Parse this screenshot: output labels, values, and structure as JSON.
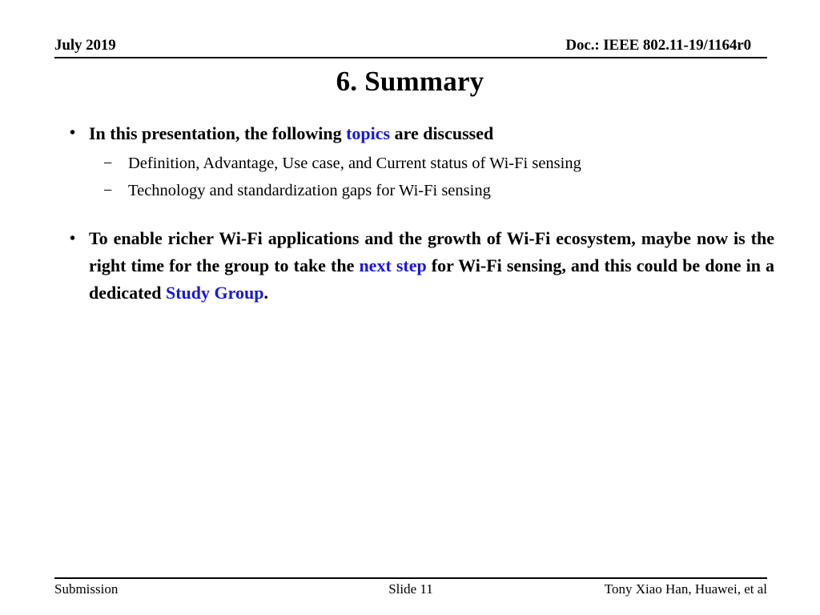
{
  "header": {
    "date": "July 2019",
    "doc_id": "Doc.: IEEE 802.11-19/1164r0"
  },
  "title": "6. Summary",
  "content": {
    "bullet1": {
      "marker": "•",
      "text_before": "In this presentation, the following ",
      "highlight": "topics",
      "text_after": " are discussed",
      "sub_marker": "−",
      "sub_items": [
        "Definition, Advantage, Use case, and Current status of Wi-Fi sensing",
        "Technology and standardization gaps for Wi-Fi sensing"
      ]
    },
    "bullet2": {
      "marker": "•",
      "part1": "To enable richer Wi-Fi applications and the growth of Wi-Fi ecosystem, maybe now is the right time for the group to take the ",
      "highlight1": "next step",
      "part2": " for Wi-Fi sensing, and this could be done in a dedicated ",
      "highlight2": "Study Group",
      "part3": "."
    }
  },
  "footer": {
    "left": "Submission",
    "center": "Slide 11",
    "right": "Tony Xiao Han, Huawei, et al"
  },
  "colors": {
    "text": "#000000",
    "highlight_blue": "#1818d8",
    "background": "#ffffff"
  }
}
